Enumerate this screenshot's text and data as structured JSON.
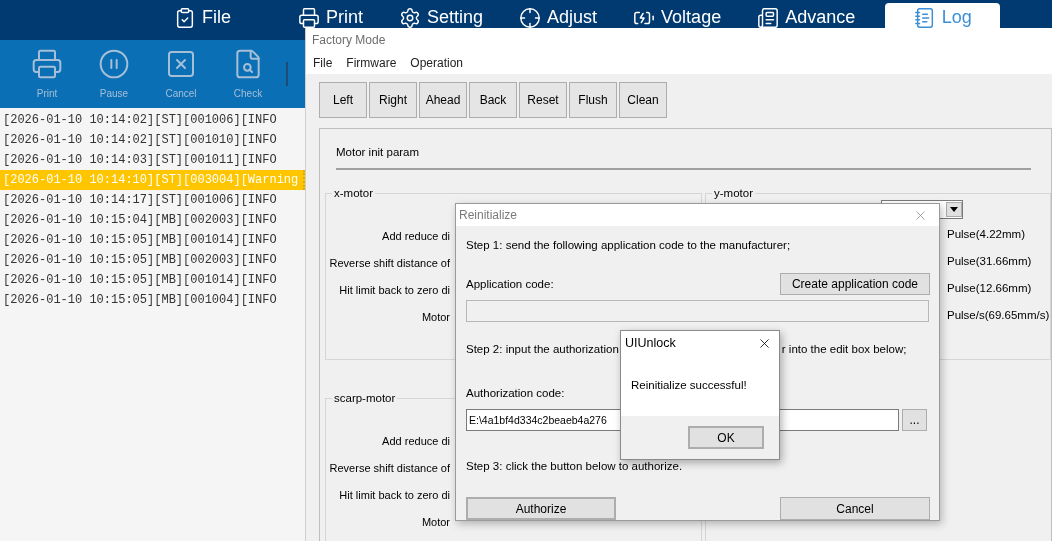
{
  "nav_tabs": [
    {
      "label": "File",
      "selected": false
    },
    {
      "label": "Print",
      "selected": false
    },
    {
      "label": "Setting",
      "selected": false
    },
    {
      "label": "Adjust",
      "selected": false
    },
    {
      "label": "Voltage",
      "selected": false
    },
    {
      "label": "Advance",
      "selected": false
    },
    {
      "label": "Log",
      "selected": true
    }
  ],
  "toolbar": [
    {
      "label": "Print",
      "disabled": true
    },
    {
      "label": "Pause",
      "disabled": true
    },
    {
      "label": "Cancel",
      "disabled": true
    },
    {
      "label": "Check",
      "disabled": true
    }
  ],
  "log": [
    {
      "text": "[2026-01-10 10:14:02][ST][001006][INFO",
      "selected": false
    },
    {
      "text": "[2026-01-10 10:14:02][ST][001010][INFO",
      "selected": false
    },
    {
      "text": "[2026-01-10 10:14:03][ST][001011][INFO",
      "selected": false
    },
    {
      "text": "[2026-01-10 10:14:10][ST][003004][Warning",
      "selected": true
    },
    {
      "text": "[2026-01-10 10:14:17][ST][001006][INFO",
      "selected": false
    },
    {
      "text": "[2026-01-10 10:15:04][MB][002003][INFO",
      "selected": false
    },
    {
      "text": "[2026-01-10 10:15:05][MB][001014][INFO",
      "selected": false
    },
    {
      "text": "[2026-01-10 10:15:05][MB][002003][INFO",
      "selected": false
    },
    {
      "text": "[2026-01-10 10:15:05][MB][001014][INFO",
      "selected": false
    },
    {
      "text": "[2026-01-10 10:15:05][MB][001004][INFO",
      "selected": false
    }
  ],
  "factory_window": {
    "title": "Factory Mode",
    "menu": [
      "File",
      "Firmware",
      "Operation"
    ],
    "buttons": [
      "Left",
      "Right",
      "Ahead",
      "Back",
      "Reset",
      "Flush",
      "Clean"
    ],
    "section_title": "Motor init param",
    "x_motor": {
      "title": "x-motor",
      "labels": [
        "Add reduce di",
        "Reverse shift distance of",
        "Hit limit back to zero di",
        "Motor"
      ]
    },
    "y_motor": {
      "title": "y-motor",
      "readings": [
        "Pulse(4.22mm)",
        "Pulse(31.66mm)",
        "Pulse(12.66mm)",
        "Pulse/s(69.65mm/s)"
      ]
    },
    "scarp_motor": {
      "title": "scarp-motor",
      "labels": [
        "Add reduce di",
        "Reverse shift distance of",
        "Hit limit back to zero di",
        "Motor"
      ]
    }
  },
  "reinit_dialog": {
    "title": "Reinitialize",
    "step1": "Step 1: send the following application code to the manufacturer;",
    "application_code_label": "Application code:",
    "create_button": "Create application code",
    "application_code_field": {
      "disabled": true
    },
    "step2_start": "Step 2: input the authorization",
    "step2_end": "r into the edit box below;",
    "authorization_code_label": "Authorization code:",
    "authorization_code_value": "E:\\4a1bf4d334c2beaeb4a276",
    "browse_button": "...",
    "step3": "Step 3: click the button below to authorize.",
    "authorize_button": "Authorize",
    "cancel_button": "Cancel"
  },
  "message_box": {
    "title": "UIUnlock",
    "message": "Reinitialize successful!",
    "ok_button": "OK"
  }
}
